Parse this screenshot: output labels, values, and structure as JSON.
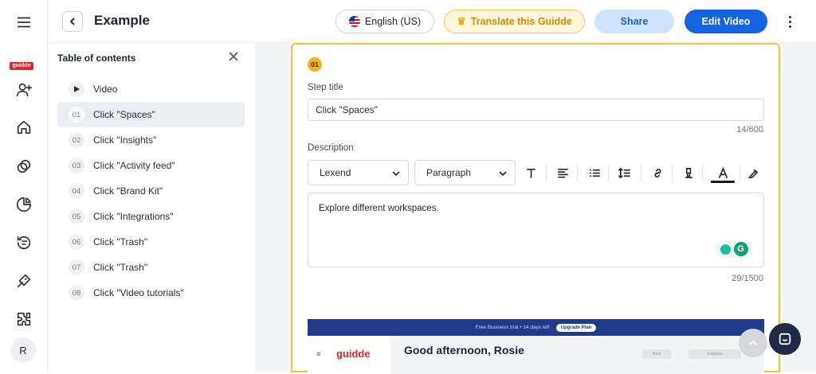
{
  "rail": {
    "brand_label": "guidde",
    "avatar_initial": "R"
  },
  "header": {
    "title": "Example",
    "language": "English (US)",
    "translate_label": "Translate this Guidde",
    "share_label": "Share",
    "edit_label": "Edit Video"
  },
  "toc": {
    "title": "Table of contents",
    "items": [
      {
        "num": "",
        "label": "Video"
      },
      {
        "num": "01",
        "label": "Click \"Spaces\""
      },
      {
        "num": "02",
        "label": "Click \"Insights\""
      },
      {
        "num": "03",
        "label": "Click \"Activity feed\""
      },
      {
        "num": "04",
        "label": "Click \"Brand Kit\""
      },
      {
        "num": "05",
        "label": "Click \"Integrations\""
      },
      {
        "num": "06",
        "label": "Click \"Trash\""
      },
      {
        "num": "07",
        "label": "Click \"Trash\""
      },
      {
        "num": "08",
        "label": "Click \"Video tutorials\""
      }
    ],
    "active_index": 1
  },
  "step": {
    "number": "01",
    "title_label": "Step title",
    "title_value": "Click \"Spaces\"",
    "title_counter": "14/600",
    "description_label": "Description",
    "font_value": "Lexend",
    "paragraph_value": "Paragraph",
    "description_value": "Explore different workspaces.",
    "description_counter": "29/1500"
  },
  "preview": {
    "banner_text": "Free Business trial • 14 days left",
    "upgrade_label": "Upgrade Plan",
    "logo": "guidde",
    "greeting": "Good afternoon, Rosie",
    "chip_1": "New",
    "chip_2": "Capture"
  },
  "colors": {
    "accent_blue": "#1463e0",
    "highlight_yellow": "#f3c53a",
    "brand_red": "#e0262d"
  }
}
